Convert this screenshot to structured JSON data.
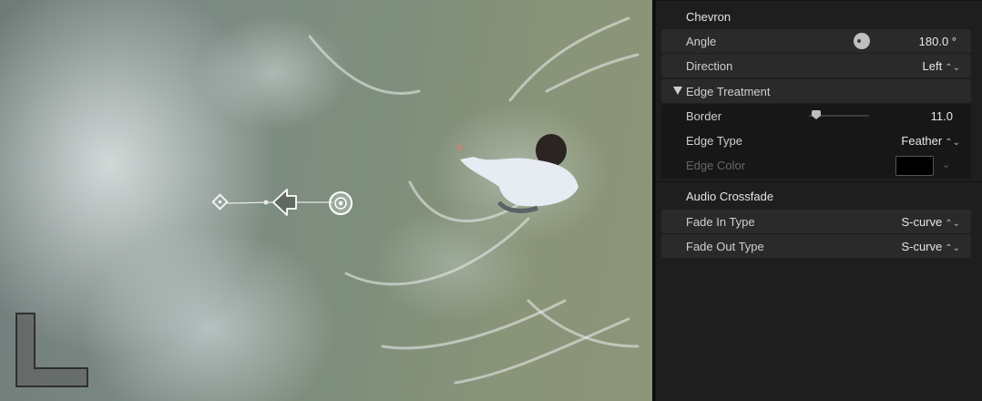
{
  "viewer": {
    "onscreen_controls": [
      "diamond-handle-icon",
      "arrow-left-icon",
      "circle-target-icon"
    ],
    "watermark_icon": "l-shape-icon"
  },
  "inspector": {
    "chevron_section": {
      "title": "Chevron",
      "angle": {
        "label": "Angle",
        "value": "180.0 °"
      },
      "direction": {
        "label": "Direction",
        "value": "Left",
        "chevron": "⌃⌄"
      }
    },
    "edge_treatment": {
      "title": "Edge Treatment",
      "border": {
        "label": "Border",
        "value": "11.0",
        "level": 0.12
      },
      "edge_type": {
        "label": "Edge Type",
        "value": "Feather",
        "chevron": "⌃⌄"
      },
      "edge_color": {
        "label": "Edge Color",
        "color": "#000000"
      }
    },
    "audio_crossfade": {
      "title": "Audio Crossfade",
      "fade_in": {
        "label": "Fade In Type",
        "value": "S-curve",
        "chevron": "⌃⌄"
      },
      "fade_out": {
        "label": "Fade Out Type",
        "value": "S-curve",
        "chevron": "⌃⌄"
      }
    }
  },
  "colors": {
    "panel_bg": "#1e1e1e",
    "row_bg": "#2a2a2a",
    "group_bg": "#171717"
  }
}
